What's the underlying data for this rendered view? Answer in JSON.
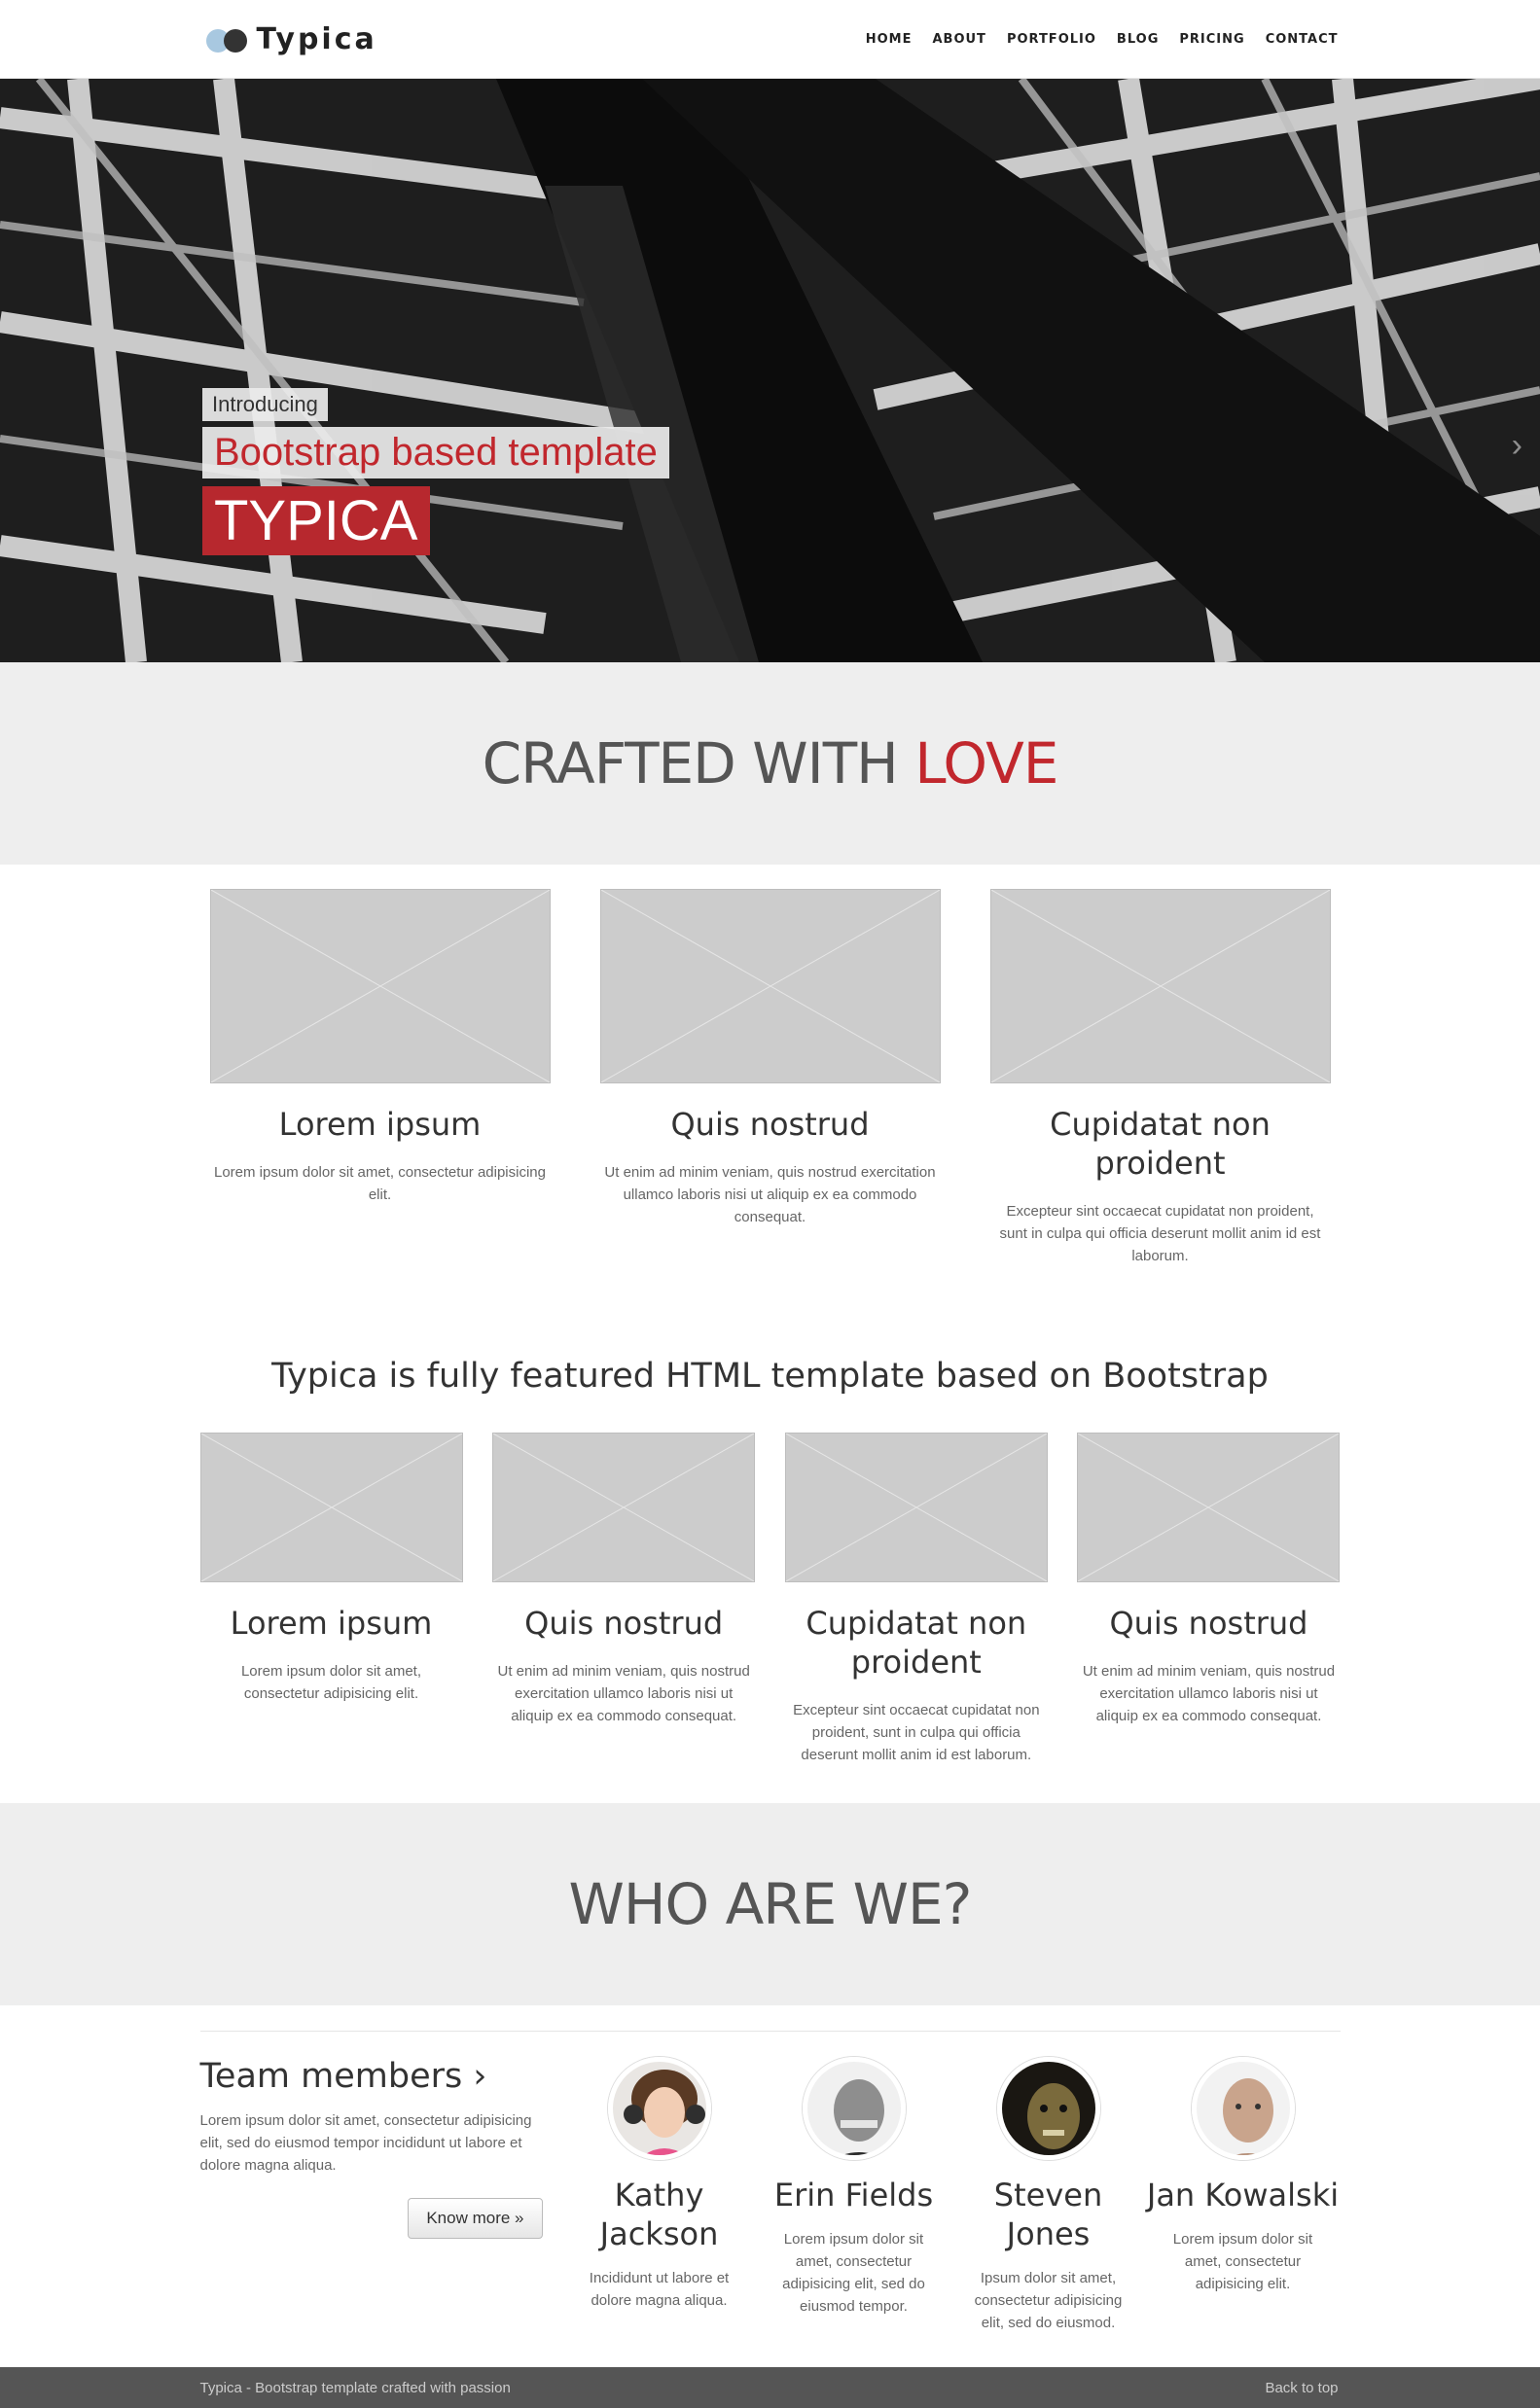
{
  "brand": {
    "name": "Typica"
  },
  "nav": [
    "HOME",
    "ABOUT",
    "PORTFOLIO",
    "BLOG",
    "PRICING",
    "CONTACT"
  ],
  "hero": {
    "intro": "Introducing",
    "subtitle": "Bootstrap based template",
    "title": "TYPICA",
    "next_icon": "chevron-right-icon"
  },
  "section1": {
    "title_main": "CRAFTED WITH ",
    "title_accent": "LOVE"
  },
  "features3": [
    {
      "title": "Lorem ipsum",
      "text": "Lorem ipsum dolor sit amet, consectetur adipisicing elit."
    },
    {
      "title": "Quis nostrud",
      "text": "Ut enim ad minim veniam, quis nostrud exercitation ullamco laboris nisi ut aliquip ex ea commodo consequat."
    },
    {
      "title": "Cupidatat non proident",
      "text": "Excepteur sint occaecat cupidatat non proident, sunt in culpa qui officia deserunt mollit anim id est laborum."
    }
  ],
  "lead": "Typica is fully featured HTML template based on Bootstrap",
  "features4": [
    {
      "title": "Lorem ipsum",
      "text": "Lorem ipsum dolor sit amet, consectetur adipisicing elit."
    },
    {
      "title": "Quis nostrud",
      "text": "Ut enim ad minim veniam, quis nostrud exercitation ullamco laboris nisi ut aliquip ex ea commodo consequat."
    },
    {
      "title": "Cupidatat non proident",
      "text": "Excepteur sint occaecat cupidatat non proident, sunt in culpa qui officia deserunt mollit anim id est laborum."
    },
    {
      "title": "Quis nostrud",
      "text": "Ut enim ad minim veniam, quis nostrud exercitation ullamco laboris nisi ut aliquip ex ea commodo consequat."
    }
  ],
  "section2": {
    "title": "WHO ARE WE?"
  },
  "team": {
    "heading": "Team members ›",
    "text": "Lorem ipsum dolor sit amet, consectetur adipisicing elit, sed do eiusmod tempor incididunt ut labore et dolore magna aliqua.",
    "button": "Know more »",
    "members": [
      {
        "name": "Kathy Jackson",
        "text": "Incididunt ut labore et dolore magna aliqua."
      },
      {
        "name": "Erin Fields",
        "text": "Lorem ipsum dolor sit amet, consectetur adipisicing elit, sed do eiusmod tempor."
      },
      {
        "name": "Steven Jones",
        "text": "Ipsum dolor sit amet, consectetur adipisicing elit, sed do eiusmod."
      },
      {
        "name": "Jan Kowalski",
        "text": "Lorem ipsum dolor sit amet, consectetur adipisicing elit."
      }
    ]
  },
  "footer": {
    "text": "Typica - Bootstrap template crafted with passion",
    "back_to_top": "Back to top"
  }
}
